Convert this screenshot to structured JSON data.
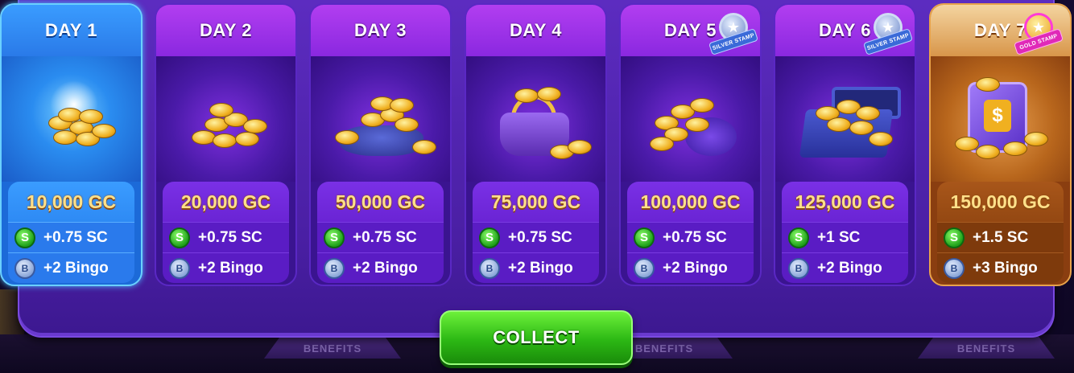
{
  "days": [
    {
      "label": "DAY 1",
      "gc": "10,000 GC",
      "sc": "+0.75 SC",
      "bingo": "+2 Bingo",
      "state": "active"
    },
    {
      "label": "DAY 2",
      "gc": "20,000 GC",
      "sc": "+0.75 SC",
      "bingo": "+2 Bingo",
      "state": "normal"
    },
    {
      "label": "DAY 3",
      "gc": "50,000 GC",
      "sc": "+0.75 SC",
      "bingo": "+2 Bingo",
      "state": "normal"
    },
    {
      "label": "DAY 4",
      "gc": "75,000 GC",
      "sc": "+0.75 SC",
      "bingo": "+2 Bingo",
      "state": "normal"
    },
    {
      "label": "DAY 5",
      "gc": "100,000 GC",
      "sc": "+0.75 SC",
      "bingo": "+2 Bingo",
      "state": "normal",
      "stamp": "SILVER STAMP"
    },
    {
      "label": "DAY 6",
      "gc": "125,000 GC",
      "sc": "+1 SC",
      "bingo": "+2 Bingo",
      "state": "normal",
      "stamp": "SILVER STAMP"
    },
    {
      "label": "DAY 7",
      "gc": "150,000 GC",
      "sc": "+1.5 SC",
      "bingo": "+3 Bingo",
      "state": "gold",
      "stamp": "GOLD STAMP"
    }
  ],
  "icons": {
    "sc_glyph": "S",
    "bingo_glyph": "B",
    "star_glyph": "★",
    "safe_glyph": "$"
  },
  "collect_label": "COLLECT",
  "benefits_label": "BENEFITS",
  "colors": {
    "accent_purple": "#5c2cc0",
    "active_blue": "#2a7ae8",
    "gold": "#d8964a",
    "collect_green": "#2cb814"
  }
}
